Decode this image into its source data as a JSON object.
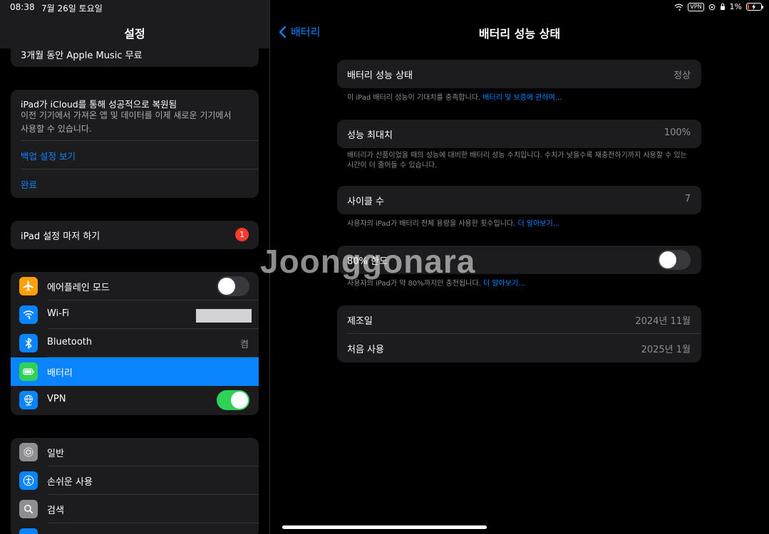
{
  "status_bar": {
    "time": "08:38",
    "date": "7월 26일 토요일",
    "vpn": "VPN",
    "battery_percent": "1%",
    "battery_level": 0.01
  },
  "left": {
    "title": "설정",
    "apple_music_offer": "3개월 동안 Apple Music 무료",
    "icloud_card": {
      "title": "iPad가 iCloud를 통해 성공적으로 복원됨",
      "description": "이전 기기에서 가져온 앱 및 데이터를 이제 새로운 기기에서 사용할 수 있습니다.",
      "view_backup": "백업 설정 보기",
      "done": "완료"
    },
    "finish_setup": {
      "label": "iPad 설정 마저 하기",
      "badge": "1"
    },
    "connectivity": [
      {
        "label": "에어플레인 모드",
        "icon": "airplane-icon",
        "color": "#ff9f0a"
      },
      {
        "label": "Wi-Fi",
        "icon": "wifi-icon",
        "color": "#0a84ff"
      },
      {
        "label": "Bluetooth",
        "icon": "bluetooth-icon",
        "color": "#0a84ff",
        "value": "켬"
      },
      {
        "label": "배터리",
        "icon": "battery-icon",
        "color": "#30d158"
      },
      {
        "label": "VPN",
        "icon": "vpn-globe-icon",
        "color": "#0a84ff"
      }
    ],
    "airplane_mode_on": false,
    "vpn_on": true,
    "general": [
      {
        "label": "일반",
        "icon": "gear-icon",
        "color": "#8e8e93"
      },
      {
        "label": "손쉬운 사용",
        "icon": "accessibility-icon",
        "color": "#0a84ff"
      },
      {
        "label": "검색",
        "icon": "search-icon",
        "color": "#8e8e93"
      }
    ]
  },
  "right": {
    "back_label": "배터리",
    "title": "배터리 성능 상태",
    "health": {
      "label": "배터리 성능 상태",
      "value": "정상"
    },
    "health_note": "이 iPad 배터리 성능이 기대치를 충족합니다.",
    "health_link": "배터리 및 보증에 관하여...",
    "max_capacity": {
      "label": "성능 최대치",
      "value": "100%"
    },
    "max_capacity_note": "배터리가 신품이었을 때의 성능에 대비한 배터리 성능 수치입니다. 수치가 낮을수록 재충전하기까지 사용할 수 있는 시간이 더 줄어들 수 있습니다.",
    "cycle_count": {
      "label": "사이클 수",
      "value": "7"
    },
    "cycle_note": "사용자의 iPad가 배터리 전체 용량을 사용한 횟수입니다.",
    "cycle_link": "더 알아보기...",
    "limit": {
      "label": "80% 한도",
      "on": false
    },
    "limit_note": "사용자의 iPad가 약 80%까지만 충전됩니다.",
    "limit_link": "더 알아보기...",
    "manufacture": {
      "label": "제조일",
      "value": "2024년 11월"
    },
    "first_use": {
      "label": "처음 사용",
      "value": "2025년 1월"
    }
  },
  "watermark": "Joonggonara"
}
